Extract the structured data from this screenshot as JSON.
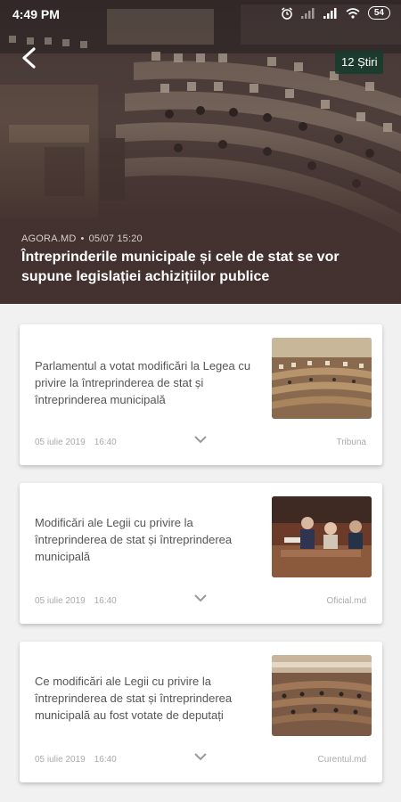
{
  "status_bar": {
    "time": "4:49 PM",
    "battery": "54"
  },
  "header": {
    "count_badge": "12 Știri",
    "source": "AGORA.MD",
    "datetime": "05/07 15:20",
    "title": "Întreprinderile municipale și cele de stat se vor supune legislației achizițiilor publice"
  },
  "articles": [
    {
      "title": "Parlamentul a votat modificări la Legea cu privire la întreprinderea de stat și întreprinderea municipală",
      "date": "05 iulie 2019",
      "time": "16:40",
      "source": "Tribuna"
    },
    {
      "title": "Modificări ale Legii cu privire la întreprinderea de stat și întreprinderea municipală",
      "date": "05 iulie 2019",
      "time": "16:40",
      "source": "Oficial.md"
    },
    {
      "title": "Ce modificări ale Legii cu privire la întreprinderea de stat și întreprinderea municipală au fost votate de deputați",
      "date": "05 iulie 2019",
      "time": "16:40",
      "source": "Curentul.md"
    }
  ],
  "icons": {
    "back": "back-arrow-icon",
    "expand": "chevron-down-icon",
    "alarm": "alarm-icon",
    "signal": "signal-icon",
    "wifi": "wifi-icon"
  }
}
